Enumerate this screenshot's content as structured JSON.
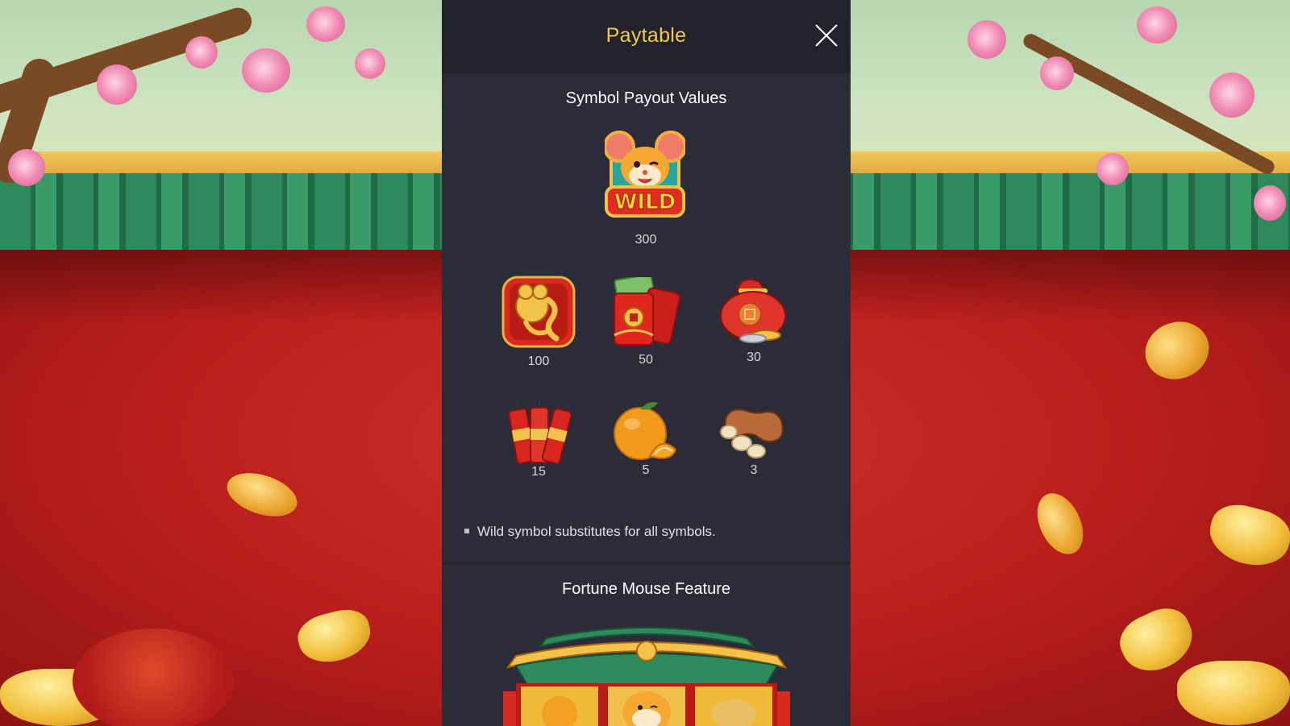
{
  "paytable": {
    "title": "Paytable",
    "section_payouts": "Symbol Payout Values",
    "symbols": [
      {
        "name": "wild-mouse",
        "label": "WILD",
        "payout": "300"
      },
      {
        "name": "gold-mouse-emblem",
        "payout": "100"
      },
      {
        "name": "red-envelope",
        "payout": "50"
      },
      {
        "name": "lucky-bag",
        "payout": "30"
      },
      {
        "name": "firecrackers",
        "payout": "15"
      },
      {
        "name": "orange",
        "payout": "5"
      },
      {
        "name": "peanuts",
        "payout": "3"
      }
    ],
    "note": "Wild symbol substitutes for all symbols.",
    "section_feature": "Fortune Mouse Feature"
  },
  "colors": {
    "title": "#f2c94c",
    "panel": "#2c2c38",
    "header": "#22222c"
  }
}
